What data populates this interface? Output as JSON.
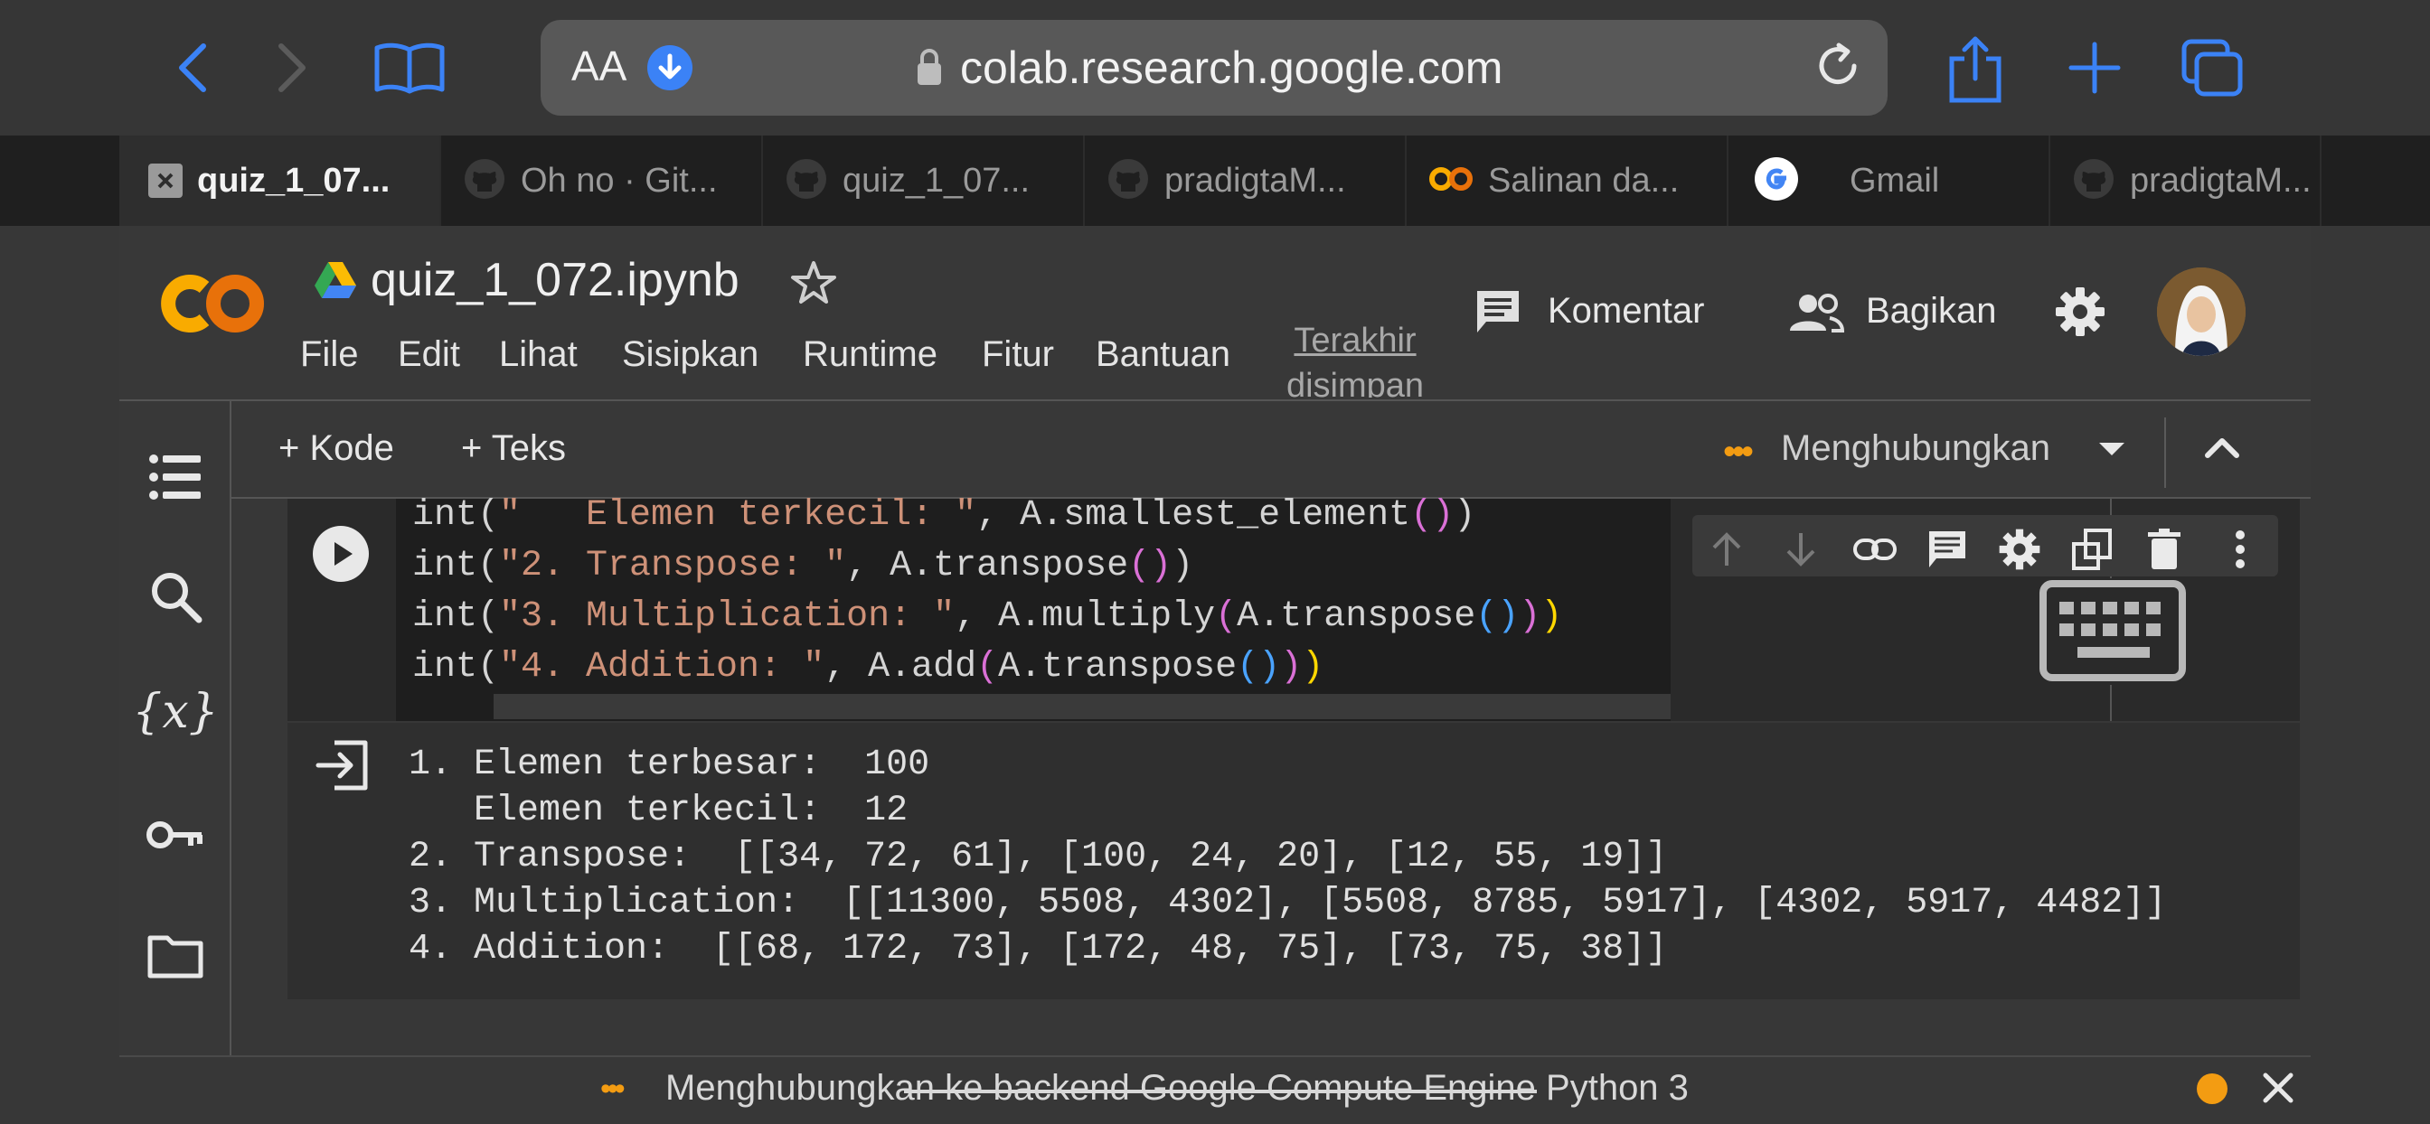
{
  "browser": {
    "text_size_label": "AA",
    "url": "colab.research.google.com",
    "tabs": [
      {
        "label": "quiz_1_07...",
        "icon": "close-icon",
        "active": true
      },
      {
        "label": "Oh no · Git...",
        "icon": "github-icon"
      },
      {
        "label": "quiz_1_07...",
        "icon": "github-icon"
      },
      {
        "label": "pradigtaM...",
        "icon": "github-icon"
      },
      {
        "label": "Salinan da...",
        "icon": "colab-icon"
      },
      {
        "label": "Gmail",
        "icon": "google-icon"
      },
      {
        "label": "pradigtaM...",
        "icon": "github-icon"
      }
    ]
  },
  "notebook": {
    "logo_text": "CO",
    "title": "quiz_1_072.ipynb",
    "menu": [
      "File",
      "Edit",
      "Lihat",
      "Sisipkan",
      "Runtime",
      "Fitur",
      "Bantuan"
    ],
    "last_saved": "Terakhir disimpan",
    "comment_label": "Komentar",
    "share_label": "Bagikan"
  },
  "toolbar": {
    "add_code": "+ Kode",
    "add_text": "+ Teks",
    "connect_status": "Menghubungkan"
  },
  "cell": {
    "code_lines": [
      [
        [
          "d",
          "int("
        ],
        [
          "s",
          "\"   Elemen terkecil: \""
        ],
        [
          "d",
          ", A.smallest_element"
        ],
        [
          "p1",
          "()"
        ],
        [
          "d",
          ")"
        ]
      ],
      [
        [
          "d",
          "int("
        ],
        [
          "s",
          "\"2. Transpose: \""
        ],
        [
          "d",
          ", A.transpose"
        ],
        [
          "p1",
          "()"
        ],
        [
          "d",
          ")"
        ]
      ],
      [
        [
          "d",
          "int("
        ],
        [
          "s",
          "\"3. Multiplication: \""
        ],
        [
          "d",
          ", A.multiply"
        ],
        [
          "p1",
          "("
        ],
        [
          "d",
          "A.transpose"
        ],
        [
          "p2",
          "()"
        ],
        [
          "p1",
          ")"
        ],
        [
          "p3",
          ")"
        ]
      ],
      [
        [
          "d",
          "int("
        ],
        [
          "s",
          "\"4. Addition: \""
        ],
        [
          "d",
          ", A.add"
        ],
        [
          "p1",
          "("
        ],
        [
          "d",
          "A.transpose"
        ],
        [
          "p2",
          "()"
        ],
        [
          "p1",
          ")"
        ],
        [
          "p3",
          ")"
        ]
      ]
    ],
    "output_lines": [
      "1. Elemen terbesar:  100",
      "   Elemen terkecil:  12",
      "2. Transpose:  [[34, 72, 61], [100, 24, 20], [12, 55, 19]]",
      "3. Multiplication:  [[11300, 5508, 4302], [5508, 8785, 5917], [4302, 5917, 4482]]",
      "4. Addition:  [[68, 172, 73], [172, 48, 75], [73, 75, 38]]"
    ]
  },
  "status": {
    "message": "Menghubungkan ke backend Google Compute Engine Python 3"
  },
  "colors": {
    "accent_blue": "#3b82f6",
    "colab_orange": "#f9ab00",
    "status_dot": "#f39c12"
  }
}
